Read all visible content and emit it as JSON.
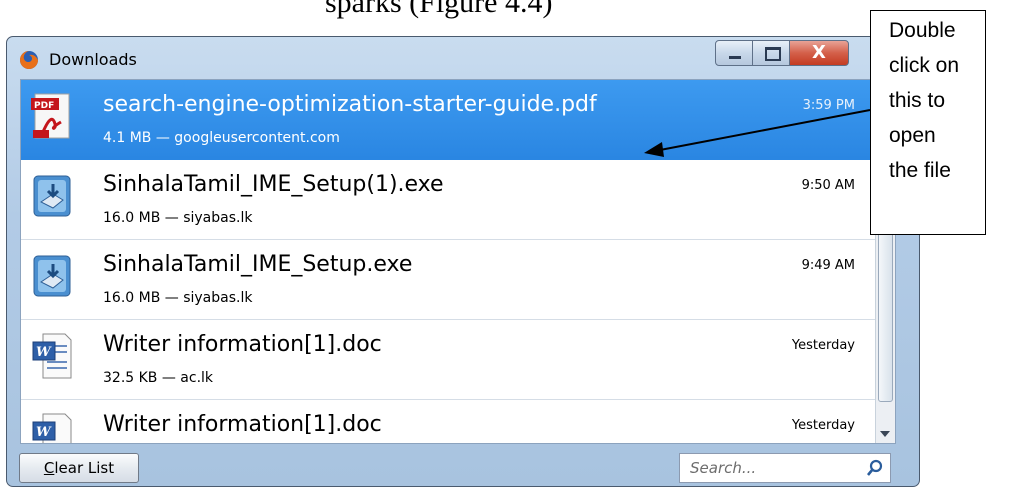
{
  "document": {
    "heading_fragment": "sparks (Figure 4.4)"
  },
  "window": {
    "title": "Downloads",
    "close_glyph": "X",
    "scrollbar_position": 0.0
  },
  "downloads": [
    {
      "name": "search-engine-optimization-starter-guide.pdf",
      "meta": "4.1 MB — googleusercontent.com",
      "time": "3:59 PM",
      "icon": "pdf-icon",
      "selected": true
    },
    {
      "name": "SinhalaTamil_IME_Setup(1).exe",
      "meta": "16.0 MB — siyabas.lk",
      "time": "9:50 AM",
      "icon": "installer-icon"
    },
    {
      "name": "SinhalaTamil_IME_Setup.exe",
      "meta": "16.0 MB — siyabas.lk",
      "time": "9:49 AM",
      "icon": "installer-icon"
    },
    {
      "name": "Writer information[1].doc",
      "meta": "32.5 KB — ac.lk",
      "time": "Yesterday",
      "icon": "word-doc-icon"
    },
    {
      "name": "Writer information[1].doc",
      "meta": "",
      "time": "Yesterday",
      "icon": "word-doc-icon"
    }
  ],
  "footer": {
    "clear_label_first": "C",
    "clear_label_rest": "lear List",
    "search_placeholder": "Search..."
  },
  "callout": {
    "lines": [
      "Double",
      "click on",
      "this to",
      "open",
      "the file"
    ]
  },
  "colors": {
    "selection": "#3d9af0",
    "window_frame": "#b2cbe6",
    "close_button": "#c43b22"
  }
}
